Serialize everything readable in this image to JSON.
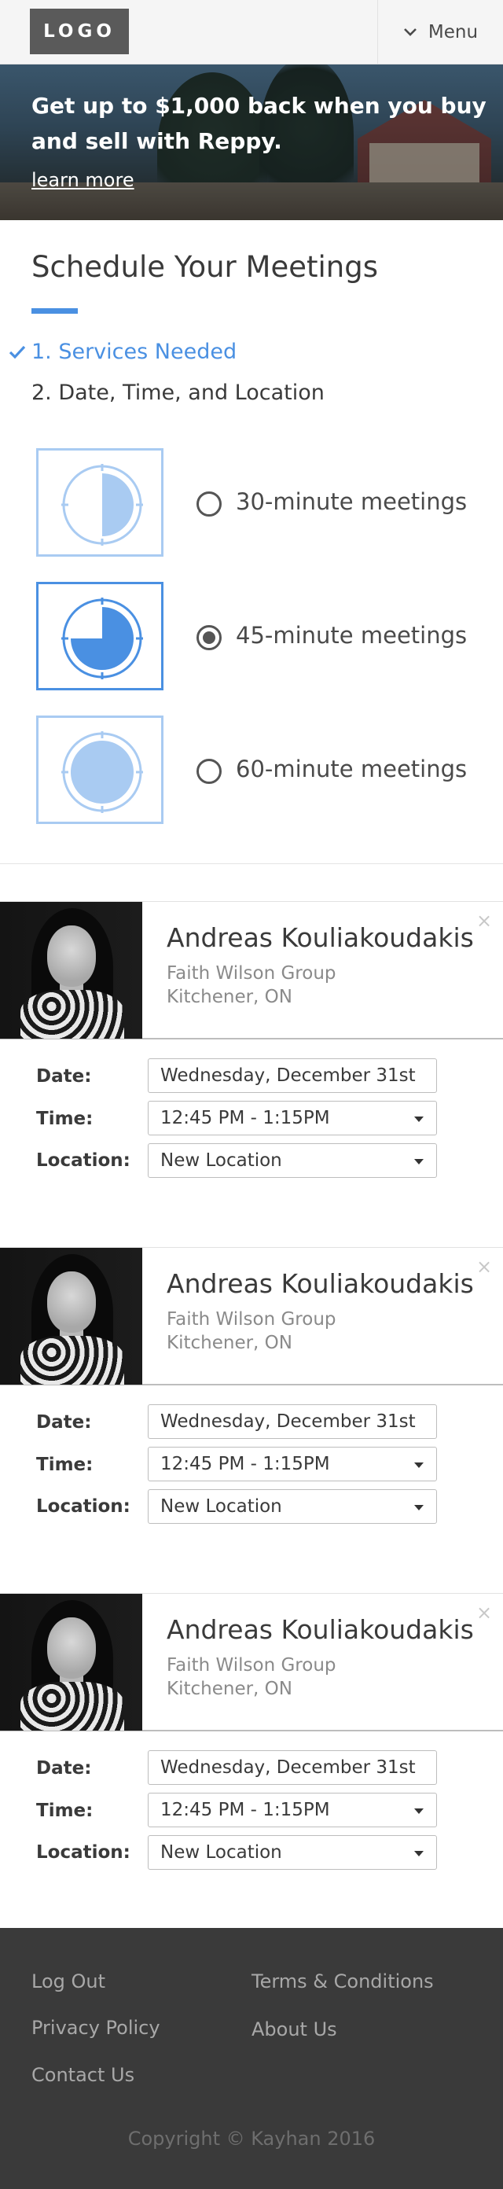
{
  "header": {
    "logo": "LOGO",
    "menu_label": "Menu",
    "menu_icon": "chevron-down-icon"
  },
  "hero": {
    "title": "Get up to $1,000 back when you buy and sell with Reppy.",
    "link": "learn more"
  },
  "schedule": {
    "title": "Schedule Your Meetings",
    "steps": [
      {
        "label": "1. Services Needed",
        "status": "done"
      },
      {
        "label": "2. Date, Time, and Location",
        "status": "current"
      }
    ],
    "options": [
      {
        "label": "30-minute meetings",
        "selected": false,
        "fill": 0.5
      },
      {
        "label": "45-minute meetings",
        "selected": true,
        "fill": 0.75
      },
      {
        "label": "60-minute meetings",
        "selected": false,
        "fill": 1.0
      }
    ]
  },
  "meetings": [
    {
      "agent_name": "Andreas Kouliakoudakis",
      "company": "Faith Wilson Group",
      "city": "Kitchener, ON",
      "date_label": "Date:",
      "date_value": "Wednesday, December 31st",
      "time_label": "Time:",
      "time_value": "12:45 PM - 1:15PM",
      "location_label": "Location:",
      "location_value": "New Location",
      "close": "×"
    },
    {
      "agent_name": "Andreas Kouliakoudakis",
      "company": "Faith Wilson Group",
      "city": "Kitchener, ON",
      "date_label": "Date:",
      "date_value": "Wednesday, December 31st",
      "time_label": "Time:",
      "time_value": "12:45 PM - 1:15PM",
      "location_label": "Location:",
      "location_value": "New Location",
      "close": "×"
    },
    {
      "agent_name": "Andreas Kouliakoudakis",
      "company": "Faith Wilson Group",
      "city": "Kitchener, ON",
      "date_label": "Date:",
      "date_value": "Wednesday, December 31st",
      "time_label": "Time:",
      "time_value": "12:45 PM - 1:15PM",
      "location_label": "Location:",
      "location_value": "New Location",
      "close": "×"
    }
  ],
  "footer": {
    "links_left": [
      "Log Out",
      "Privacy Policy",
      "Contact Us"
    ],
    "links_right": [
      "Terms & Conditions",
      "About Us"
    ],
    "copyright": "Copyright © Kayhan 2016"
  },
  "colors": {
    "accent": "#4a90e2",
    "accent_light": "#a9cbf2",
    "footer_bg": "#3a3a3a"
  }
}
